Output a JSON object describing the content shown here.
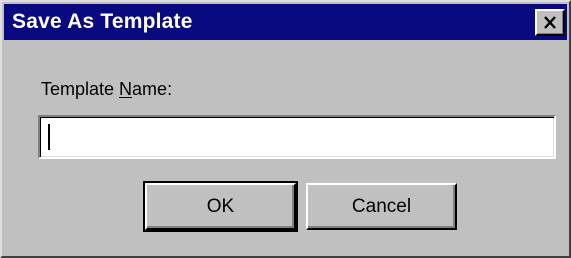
{
  "window": {
    "title": "Save As Template"
  },
  "form": {
    "label_prefix": "Template ",
    "label_mnemonic": "N",
    "label_suffix": "ame:",
    "template_name_value": "",
    "template_name_placeholder": ""
  },
  "buttons": {
    "ok_label": "OK",
    "cancel_label": "Cancel"
  },
  "icons": {
    "close": "close-icon"
  },
  "colors": {
    "titlebar": "#0a0a80",
    "face": "#c0c0c0"
  }
}
